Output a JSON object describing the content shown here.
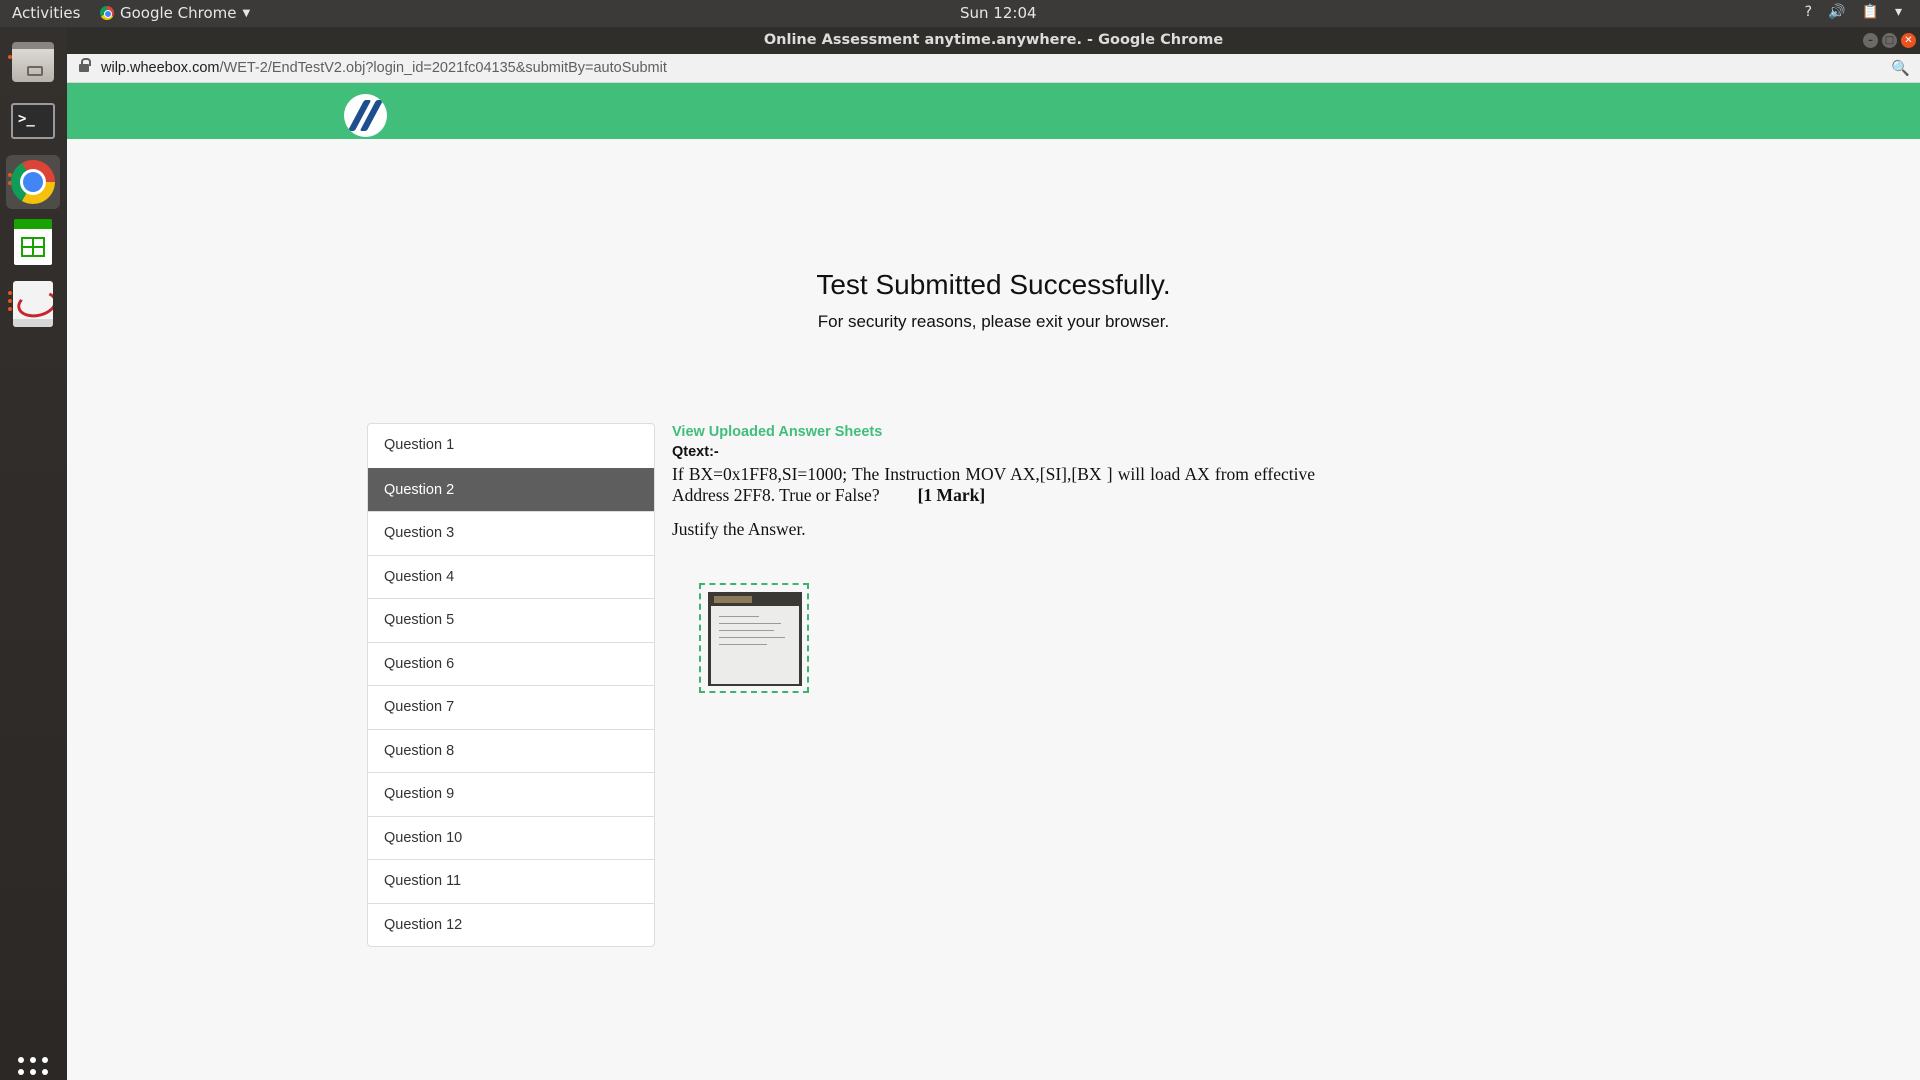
{
  "system": {
    "activities_label": "Activities",
    "app_menu_label": "Google Chrome",
    "clock": "Sun 12:04",
    "tray": {
      "help": "?",
      "volume": "🔊",
      "clipboard": "📋"
    }
  },
  "window": {
    "title": "Online Assessment anytime.anywhere. - Google Chrome"
  },
  "address_bar": {
    "host": "wilp.wheebox.com",
    "path": "/WET-2/EndTestV2.obj?login_id=2021fc04135&submitBy=autoSubmit",
    "zoom_icon": "🔍"
  },
  "dock": {
    "items": [
      "Files",
      "Terminal",
      "Google Chrome",
      "LibreOffice Calc",
      "Document Viewer"
    ],
    "terminal_glyph": ">_"
  },
  "page": {
    "success_title": "Test Submitted Successfully.",
    "success_subtitle": "For security reasons, please exit your browser.",
    "questions": [
      "Question 1",
      "Question 2",
      "Question 3",
      "Question 4",
      "Question 5",
      "Question 6",
      "Question 7",
      "Question 8",
      "Question 9",
      "Question 10",
      "Question 11",
      "Question 12"
    ],
    "active_question_index": 1,
    "view_sheets_link": "View Uploaded Answer Sheets",
    "qtext_label": "Qtext:-",
    "qtext": "If BX=0x1FF8,SI=1000; The Instruction MOV AX,[SI],[BX ] will load AX from effective Address  2FF8. True or False?",
    "qtext_mark": "[1 Mark]",
    "justify": "Justify the Answer."
  },
  "colors": {
    "brand_green": "#40be7a",
    "active_question_bg": "#5e5e5e",
    "ubuntu_orange": "#e95420"
  }
}
